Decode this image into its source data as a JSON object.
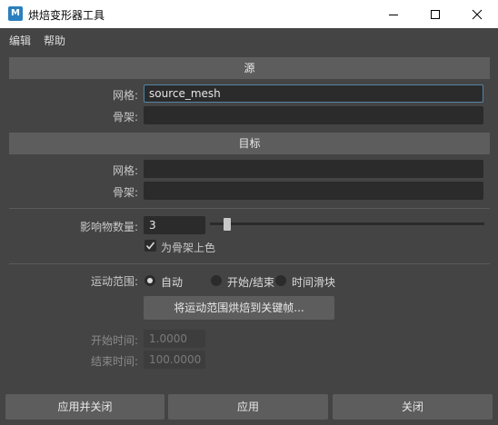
{
  "window": {
    "title": "烘焙变形器工具",
    "icon_label": "M"
  },
  "menu": {
    "items": [
      "编辑",
      "帮助"
    ]
  },
  "source": {
    "header": "源",
    "mesh_label": "网格:",
    "mesh_value": "source_mesh",
    "skeleton_label": "骨架:",
    "skeleton_value": ""
  },
  "target": {
    "header": "目标",
    "mesh_label": "网格:",
    "mesh_value": "",
    "skeleton_label": "骨架:",
    "skeleton_value": ""
  },
  "influence": {
    "label": "影响物数量:",
    "value": "3",
    "slider_fraction": 0.05,
    "color_by_skeleton_label": "为骨架上色",
    "color_by_skeleton_checked": true
  },
  "motion_range": {
    "label": "运动范围:",
    "options": [
      "自动",
      "开始/结束",
      "时间滑块"
    ],
    "selected": "自动",
    "bake_button": "将运动范围烘焙到关键帧...",
    "start_label": "开始时间:",
    "start_value": "1.0000",
    "end_label": "结束时间:",
    "end_value": "100.0000"
  },
  "buttons": {
    "apply_close": "应用并关闭",
    "apply": "应用",
    "close": "关闭"
  },
  "colors": {
    "background": "#444444",
    "section_header": "#5d5d5d",
    "field": "#2b2b2b",
    "focus_border": "#5285a6"
  }
}
